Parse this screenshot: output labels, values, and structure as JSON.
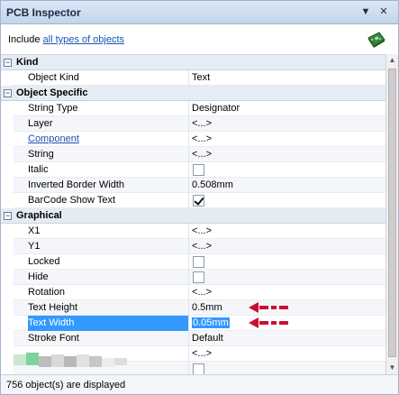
{
  "window": {
    "title": "PCB Inspector"
  },
  "include": {
    "prefix": "Include",
    "link": "all types of objects"
  },
  "icons": {
    "dropdown": "dropdown-triangle-icon",
    "close": "close-icon",
    "pcb": "pcb-board-icon"
  },
  "colors": {
    "selection": "#3399ff",
    "link": "#1a55b5",
    "arrow": "#c8102e"
  },
  "sections": [
    {
      "label": "Kind",
      "rows": [
        {
          "name": "Object Kind",
          "value": "Text"
        }
      ]
    },
    {
      "label": "Object Specific",
      "rows": [
        {
          "name": "String Type",
          "value": "Designator"
        },
        {
          "name": "Layer",
          "value": "<...>"
        },
        {
          "name": "Component",
          "value": "<...>",
          "link": true
        },
        {
          "name": "String",
          "value": "<...>"
        },
        {
          "name": "Italic",
          "checkbox": false
        },
        {
          "name": "Inverted Border Width",
          "value": "0.508mm"
        },
        {
          "name": "BarCode Show Text",
          "checkbox": true
        }
      ]
    },
    {
      "label": "Graphical",
      "rows": [
        {
          "name": "X1",
          "value": "<...>"
        },
        {
          "name": "Y1",
          "value": "<...>"
        },
        {
          "name": "Locked",
          "checkbox": false
        },
        {
          "name": "Hide",
          "checkbox": false
        },
        {
          "name": "Rotation",
          "value": "<...>"
        },
        {
          "name": "Text Height",
          "value": "0.5mm",
          "arrow": true
        },
        {
          "name": "Text Width",
          "value": "0.05mm",
          "selected": true,
          "arrow": true
        },
        {
          "name": "Stroke Font",
          "value": "Default"
        },
        {
          "name": "",
          "value": "<...>"
        },
        {
          "name": "",
          "checkbox": false
        }
      ]
    }
  ],
  "status": {
    "text": "756 object(s) are displayed"
  }
}
